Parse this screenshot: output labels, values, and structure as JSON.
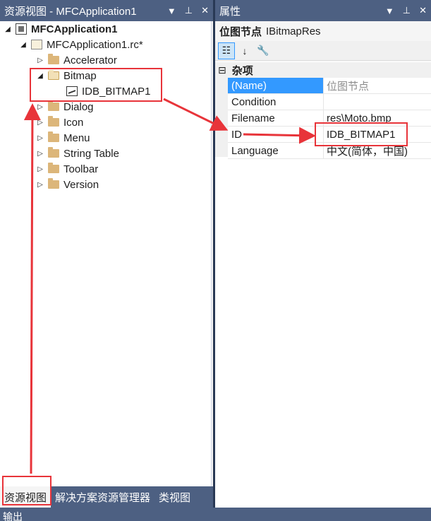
{
  "left_panel": {
    "title": "资源视图 - MFCApplication1",
    "title_buttons": [
      "▾",
      "ᐧ",
      "✕"
    ],
    "tree": {
      "project": "MFCApplication1",
      "rc_file": "MFCApplication1.rc*",
      "folders": [
        "Accelerator",
        "Bitmap",
        "Dialog",
        "Icon",
        "Menu",
        "String Table",
        "Toolbar",
        "Version"
      ],
      "bitmap_child": "IDB_BITMAP1"
    },
    "tabs": [
      "资源视图",
      "解决方案资源管理器",
      "类视图"
    ]
  },
  "output_label": "输出",
  "right_panel": {
    "title": "属性",
    "object_name": "位图节点",
    "object_type": "IBitmapRes",
    "category": "杂项",
    "properties": [
      {
        "name": "(Name)",
        "value": "位图节点"
      },
      {
        "name": "Condition",
        "value": ""
      },
      {
        "name": "Filename",
        "value": "res\\Moto.bmp"
      },
      {
        "name": "ID",
        "value": "IDB_BITMAP1"
      },
      {
        "name": "Language",
        "value": "中文(简体，中国)"
      }
    ]
  },
  "colors": {
    "titlebar": "#4d6082",
    "accent": "#3399ff",
    "annotation": "#e8343a"
  }
}
